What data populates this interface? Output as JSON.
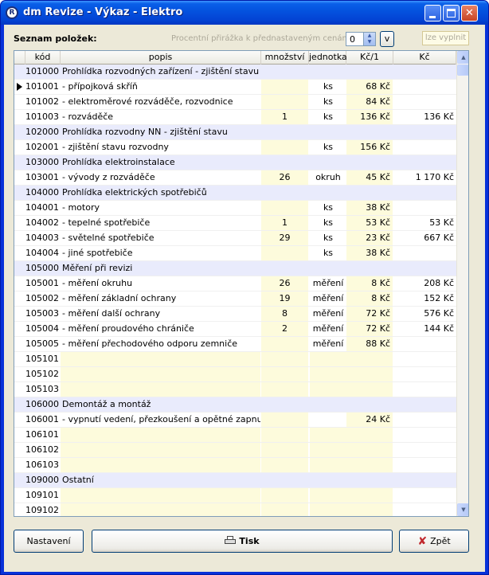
{
  "window": {
    "title": "dm Revize - Výkaz - Elektro",
    "app_icon": "R"
  },
  "toolbar": {
    "list_label": "Seznam položek:",
    "percent_label": "Procentní přirážka k přednastaveným cenám:",
    "percent_value": "0",
    "v_button": "v",
    "fill_button": "lze vyplnit"
  },
  "grid": {
    "columns": {
      "code": "kód",
      "desc": "popis",
      "qty": "množství",
      "unit": "jednotka",
      "price": "Kč/1",
      "total": "Kč"
    },
    "rows": [
      {
        "code": "101000",
        "desc": "Prohlídka rozvodných zařízení - zjištění stavu",
        "qty": "",
        "unit": "",
        "price": "",
        "total": "",
        "group": true
      },
      {
        "code": "101001",
        "desc": "- přípojková skříň",
        "qty": "",
        "unit": "ks",
        "price": "68 Kč",
        "total": "",
        "group": false,
        "current": true
      },
      {
        "code": "101002",
        "desc": "- elektroměrové rozváděče, rozvodnice",
        "qty": "",
        "unit": "ks",
        "price": "84 Kč",
        "total": "",
        "group": false
      },
      {
        "code": "101003",
        "desc": "- rozváděče",
        "qty": "1",
        "unit": "ks",
        "price": "136 Kč",
        "total": "136 Kč",
        "group": false
      },
      {
        "code": "102000",
        "desc": "Prohlídka rozvodny NN - zjištění stavu",
        "qty": "",
        "unit": "",
        "price": "",
        "total": "",
        "group": true
      },
      {
        "code": "102001",
        "desc": "- zjištění stavu rozvodny",
        "qty": "",
        "unit": "ks",
        "price": "156 Kč",
        "total": "",
        "group": false
      },
      {
        "code": "103000",
        "desc": "Prohlídka elektroinstalace",
        "qty": "",
        "unit": "",
        "price": "",
        "total": "",
        "group": true
      },
      {
        "code": "103001",
        "desc": "- vývody z rozváděče",
        "qty": "26",
        "unit": "okruh",
        "price": "45 Kč",
        "total": "1 170 Kč",
        "group": false
      },
      {
        "code": "104000",
        "desc": "Prohlídka elektrických spotřebičů",
        "qty": "",
        "unit": "",
        "price": "",
        "total": "",
        "group": true
      },
      {
        "code": "104001",
        "desc": "- motory",
        "qty": "",
        "unit": "ks",
        "price": "38 Kč",
        "total": "",
        "group": false
      },
      {
        "code": "104002",
        "desc": "- tepelné spotřebiče",
        "qty": "1",
        "unit": "ks",
        "price": "53 Kč",
        "total": "53 Kč",
        "group": false
      },
      {
        "code": "104003",
        "desc": "- světelné spotřebiče",
        "qty": "29",
        "unit": "ks",
        "price": "23 Kč",
        "total": "667 Kč",
        "group": false
      },
      {
        "code": "104004",
        "desc": "- jiné spotřebiče",
        "qty": "",
        "unit": "ks",
        "price": "38 Kč",
        "total": "",
        "group": false
      },
      {
        "code": "105000",
        "desc": "Měření při revizi",
        "qty": "",
        "unit": "",
        "price": "",
        "total": "",
        "group": true
      },
      {
        "code": "105001",
        "desc": "- měření okruhu",
        "qty": "26",
        "unit": "měření",
        "price": "8 Kč",
        "total": "208 Kč",
        "group": false
      },
      {
        "code": "105002",
        "desc": "- měření základní ochrany",
        "qty": "19",
        "unit": "měření",
        "price": "8 Kč",
        "total": "152 Kč",
        "group": false
      },
      {
        "code": "105003",
        "desc": "- měření další ochrany",
        "qty": "8",
        "unit": "měření",
        "price": "72 Kč",
        "total": "576 Kč",
        "group": false
      },
      {
        "code": "105004",
        "desc": "- měření proudového chrániče",
        "qty": "2",
        "unit": "měření",
        "price": "72 Kč",
        "total": "144 Kč",
        "group": false
      },
      {
        "code": "105005",
        "desc": "- měření přechodového odporu zemniče",
        "qty": "",
        "unit": "měření",
        "price": "88 Kč",
        "total": "",
        "group": false
      },
      {
        "code": "105101",
        "desc": "",
        "qty": "",
        "unit": "",
        "price": "",
        "total": "",
        "group": false,
        "blank": true
      },
      {
        "code": "105102",
        "desc": "",
        "qty": "",
        "unit": "",
        "price": "",
        "total": "",
        "group": false,
        "blank": true
      },
      {
        "code": "105103",
        "desc": "",
        "qty": "",
        "unit": "",
        "price": "",
        "total": "",
        "group": false,
        "blank": true
      },
      {
        "code": "106000",
        "desc": "Demontáž a montáž",
        "qty": "",
        "unit": "",
        "price": "",
        "total": "",
        "group": true
      },
      {
        "code": "106001",
        "desc": "- vypnutí vedení, přezkoušení a opětné zapnutí",
        "qty": "",
        "unit": "",
        "price": "24 Kč",
        "total": "",
        "group": false,
        "white_unit": true
      },
      {
        "code": "106101",
        "desc": "",
        "qty": "",
        "unit": "",
        "price": "",
        "total": "",
        "group": false,
        "blank": true
      },
      {
        "code": "106102",
        "desc": "",
        "qty": "",
        "unit": "",
        "price": "",
        "total": "",
        "group": false,
        "blank": true
      },
      {
        "code": "106103",
        "desc": "",
        "qty": "",
        "unit": "",
        "price": "",
        "total": "",
        "group": false,
        "blank": true
      },
      {
        "code": "109000",
        "desc": "Ostatní",
        "qty": "",
        "unit": "",
        "price": "",
        "total": "",
        "group": true
      },
      {
        "code": "109101",
        "desc": "",
        "qty": "",
        "unit": "",
        "price": "",
        "total": "",
        "group": false,
        "blank": true
      },
      {
        "code": "109102",
        "desc": "",
        "qty": "",
        "unit": "",
        "price": "",
        "total": "",
        "group": false,
        "blank": true
      }
    ]
  },
  "buttons": {
    "settings": "Nastavení",
    "print": "Tisk",
    "back": "Zpět"
  },
  "colors": {
    "group_row": "#e9ebfc",
    "editable_cell": "#fdfbdc",
    "title_bar": "#0453df"
  }
}
